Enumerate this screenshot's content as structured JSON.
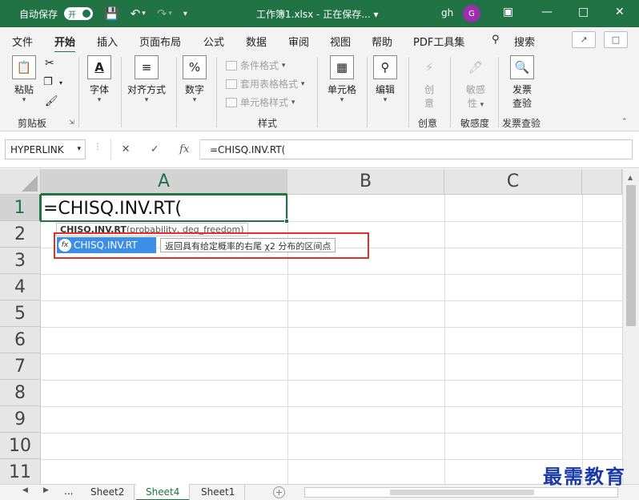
{
  "titlebar": {
    "autosave_label": "自动保存",
    "toggle_label": "开",
    "title": "工作簿1.xlsx  -  正在保存...  ▾",
    "user": "gh",
    "avatar_letter": "G"
  },
  "tabs": [
    "文件",
    "开始",
    "插入",
    "页面布局",
    "公式",
    "数据",
    "审阅",
    "视图",
    "帮助",
    "PDF工具集"
  ],
  "search_label": "搜索",
  "ribbon": {
    "paste": "粘贴",
    "clipboard": "剪贴板",
    "font": "字体",
    "align": "对齐方式",
    "number": "数字",
    "cond_format": "条件格式",
    "table_format": "套用表格格式",
    "cell_style": "单元格样式",
    "styles": "样式",
    "cells": "单元格",
    "edit": "编辑",
    "create_line1": "创",
    "create_line2": "意",
    "create": "创意",
    "sensitivity_line1": "敏感",
    "sensitivity_line2": "性",
    "sensitivity": "敏感度",
    "invoice_line1": "发票",
    "invoice_line2": "查验",
    "invoice": "发票查验"
  },
  "formula_bar": {
    "name_box": "HYPERLINK",
    "fx_label": "fx",
    "formula": "=CHISQ.INV.RT("
  },
  "grid": {
    "columns": [
      "A",
      "B",
      "C"
    ],
    "rows": [
      "1",
      "2",
      "3",
      "4",
      "5",
      "6",
      "7",
      "8",
      "9",
      "10",
      "11"
    ],
    "active_cell_text": "=CHISQ.INV.RT(",
    "arg_tip_func": "CHISQ.INV.RT",
    "arg_tip_args": "(probability, deg_freedom)",
    "autocomplete_item": "CHISQ.INV.RT",
    "autocomplete_icon": "fx",
    "autocomplete_desc": "返回具有给定概率的右尾 χ2 分布的区间点"
  },
  "sheets": {
    "dots": "...",
    "tabs": [
      "Sheet2",
      "Sheet4",
      "Sheet1"
    ],
    "active": "Sheet4"
  },
  "watermark": "最需教育",
  "colors": {
    "accent": "#217346",
    "highlight": "#e0302a",
    "selection": "#3d8ee6"
  }
}
